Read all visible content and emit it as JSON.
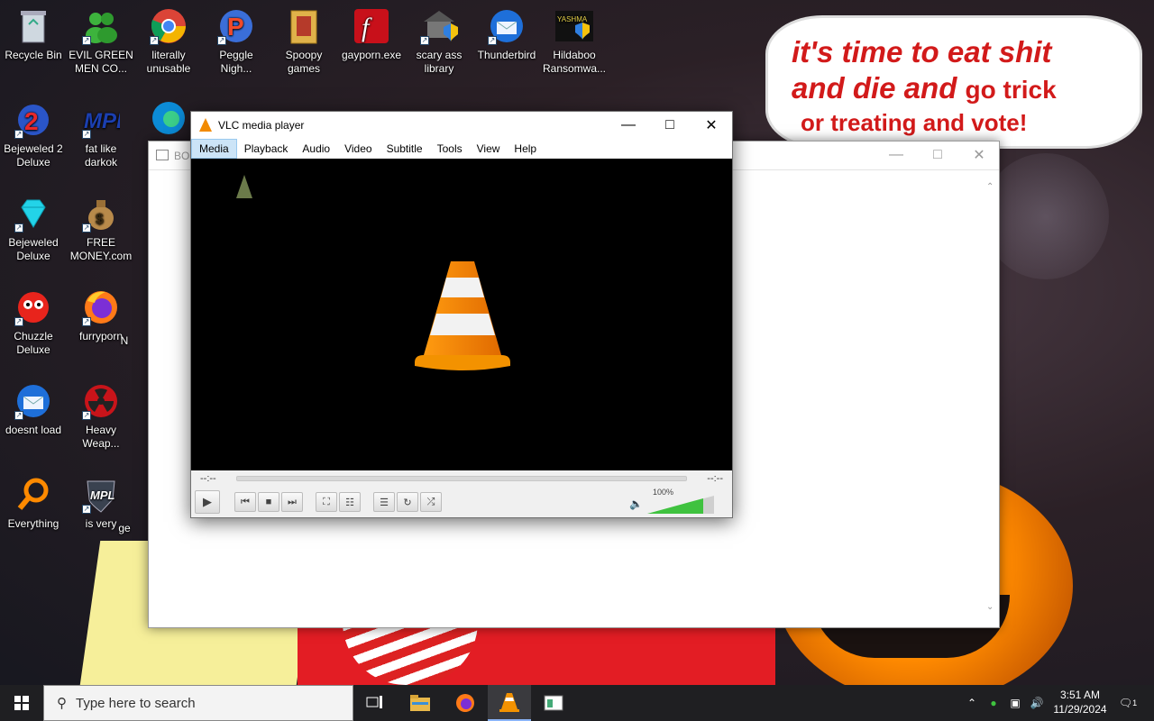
{
  "wallpaper": {
    "caption_line1": "it's time to eat shit",
    "caption_line2a": "and die and ",
    "caption_line2b": "go trick",
    "caption_line3": "or treating and vote!"
  },
  "desktop_icons": [
    {
      "label": "Recycle Bin",
      "icon": "recycle-bin-icon"
    },
    {
      "label": "EVIL GREEN MEN CO...",
      "icon": "green-men-icon"
    },
    {
      "label": "literally unusable",
      "icon": "chrome-icon"
    },
    {
      "label": "Peggle Nigh...",
      "icon": "peggle-icon"
    },
    {
      "label": "Spoopy games",
      "icon": "folder-icon"
    },
    {
      "label": "gayporn.exe",
      "icon": "flash-icon"
    },
    {
      "label": "scary ass library",
      "icon": "library-icon"
    },
    {
      "label": "Thunderbird",
      "icon": "thunderbird-icon"
    },
    {
      "label": "Hildaboo Ransomwa...",
      "icon": "yashma-icon"
    },
    {
      "label": "Bejeweled 2 Deluxe",
      "icon": "bejeweled2-icon"
    },
    {
      "label": "fat like darkok",
      "icon": "mpl-icon"
    },
    {
      "label": "Bejeweled Deluxe",
      "icon": "diamond-icon"
    },
    {
      "label": "FREE MONEY.com",
      "icon": "money-bag-icon"
    },
    {
      "label": "Chuzzle Deluxe",
      "icon": "chuzzle-icon"
    },
    {
      "label": "furryporn",
      "icon": "firefox-icon"
    },
    {
      "label": "doesnt load",
      "icon": "thunderbird-icon"
    },
    {
      "label": "Heavy Weap...",
      "icon": "radiation-icon"
    },
    {
      "label": "Everything",
      "icon": "magnifier-icon"
    },
    {
      "label": "is very",
      "icon": "mpl-shield-icon"
    }
  ],
  "partial_labels": {
    "n": "N",
    "ge": "ge"
  },
  "background_window": {
    "title": "BO"
  },
  "vlc": {
    "title": "VLC media player",
    "menu": [
      "Media",
      "Playback",
      "Audio",
      "Video",
      "Subtitle",
      "Tools",
      "View",
      "Help"
    ],
    "selected_menu": "Media",
    "time_elapsed": "--:--",
    "time_total": "--:--",
    "volume_label": "100%",
    "volume_level": 1.0,
    "seek_position": 0
  },
  "taskbar": {
    "search_placeholder": "Type here to search",
    "pinned": [
      "task-view-icon",
      "file-explorer-icon",
      "firefox-icon",
      "vlc-icon",
      "window-app-icon"
    ],
    "active": "vlc-icon",
    "clock_time": "3:51 AM",
    "clock_date": "11/29/2024",
    "notification_count": "1"
  },
  "colors": {
    "taskbar": "#1f1f22",
    "vlc_orange": "#f28a00",
    "caption_red": "#d21a1a",
    "volume_green": "#3fc23f"
  }
}
